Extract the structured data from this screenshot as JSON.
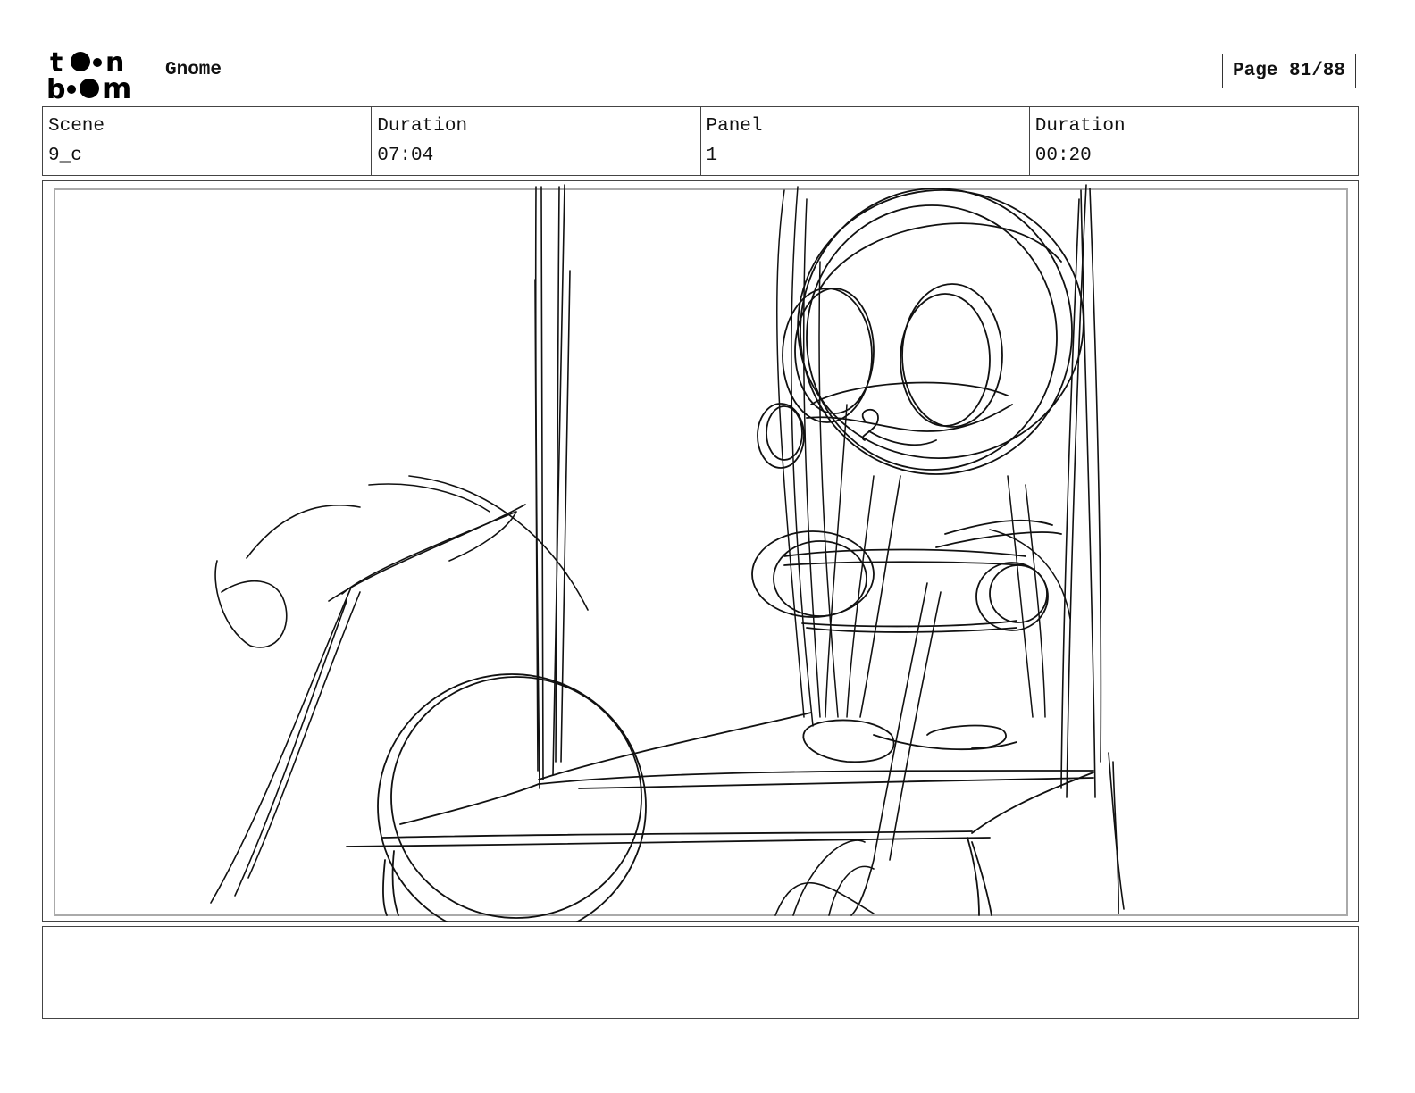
{
  "header": {
    "logo_name": "toon-boom-logo",
    "project_title": "Gnome",
    "page_label": "Page 81/88"
  },
  "info": {
    "scene_label": "Scene",
    "scene_value": "9_c",
    "duration_label": "Duration",
    "duration_value": "07:04",
    "panel_label": "Panel",
    "panel_value": "1",
    "panel_duration_label": "Duration",
    "panel_duration_value": "00:20"
  },
  "notes": {
    "text": ""
  }
}
